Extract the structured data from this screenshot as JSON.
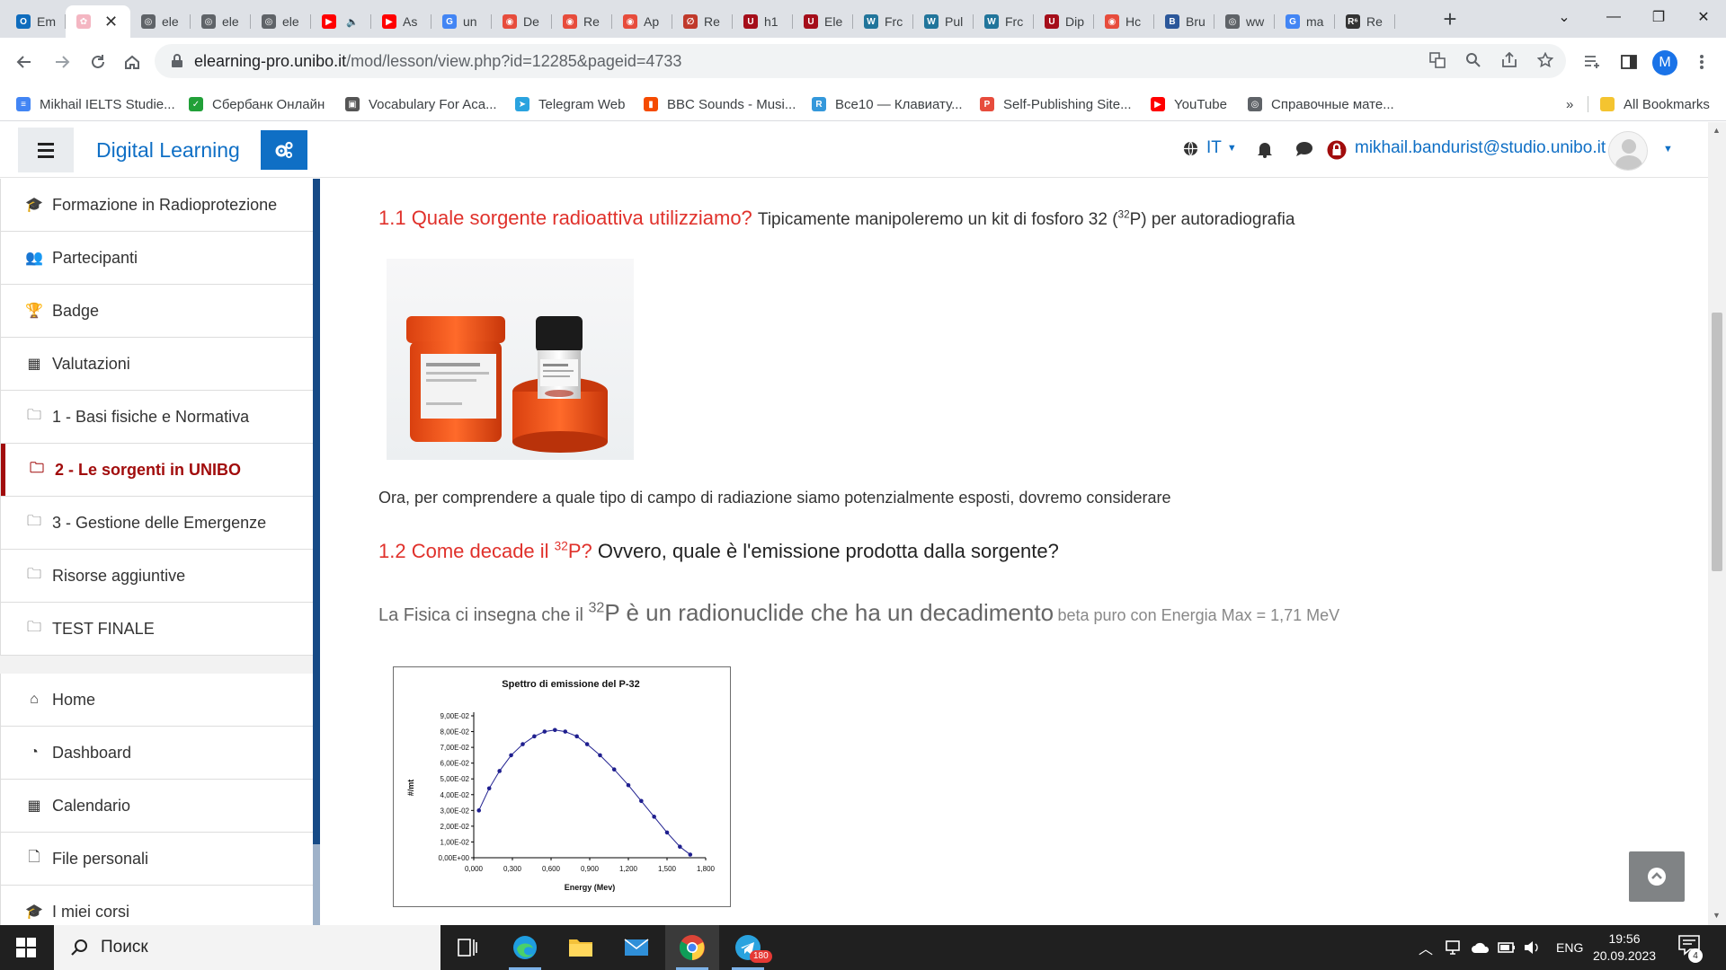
{
  "browser": {
    "tabs": [
      {
        "label": "Em",
        "icon": "outlook",
        "color": "#0f6cbd",
        "glyph": "O"
      },
      {
        "label": "",
        "icon": "flower",
        "color": "#f4b6c2",
        "glyph": "✿",
        "active": true,
        "close": "✕"
      },
      {
        "label": "ele",
        "icon": "globe",
        "color": "#5f6368",
        "glyph": "◎"
      },
      {
        "label": "ele",
        "icon": "globe",
        "color": "#5f6368",
        "glyph": "◎"
      },
      {
        "label": "ele",
        "icon": "globe",
        "color": "#5f6368",
        "glyph": "◎"
      },
      {
        "label": "",
        "icon": "youtube",
        "color": "#ff0000",
        "glyph": "▶",
        "extra": "🔈"
      },
      {
        "label": "As",
        "icon": "youtube",
        "color": "#ff0000",
        "glyph": "▶"
      },
      {
        "label": "un",
        "icon": "google",
        "color": "#4285f4",
        "glyph": "G"
      },
      {
        "label": "De",
        "icon": "circle-red",
        "color": "#e74c3c",
        "glyph": "◉"
      },
      {
        "label": "Re",
        "icon": "circle-red",
        "color": "#e74c3c",
        "glyph": "◉"
      },
      {
        "label": "Ap",
        "icon": "circle-red",
        "color": "#e74c3c",
        "glyph": "◉"
      },
      {
        "label": "Re",
        "icon": "researchgate",
        "color": "#c0392b",
        "glyph": "∅"
      },
      {
        "label": "h1",
        "icon": "shield",
        "color": "#a50e1a",
        "glyph": "U"
      },
      {
        "label": "Ele",
        "icon": "shield",
        "color": "#a50e1a",
        "glyph": "U"
      },
      {
        "label": "Frc",
        "icon": "wordpress",
        "color": "#21759b",
        "glyph": "W"
      },
      {
        "label": "Pul",
        "icon": "wordpress",
        "color": "#21759b",
        "glyph": "W"
      },
      {
        "label": "Frc",
        "icon": "wordpress",
        "color": "#21759b",
        "glyph": "W"
      },
      {
        "label": "Dip",
        "icon": "shield",
        "color": "#a50e1a",
        "glyph": "U"
      },
      {
        "label": "Hc",
        "icon": "circle-red",
        "color": "#e74c3c",
        "glyph": "◉"
      },
      {
        "label": "Bru",
        "icon": "doc",
        "color": "#2b579a",
        "glyph": "B"
      },
      {
        "label": "ww",
        "icon": "globe",
        "color": "#5f6368",
        "glyph": "◎"
      },
      {
        "label": "ma",
        "icon": "google",
        "color": "#4285f4",
        "glyph": "G"
      },
      {
        "label": "Re",
        "icon": "r6",
        "color": "#333333",
        "glyph": "R⁶"
      }
    ],
    "new_tab": "+",
    "window_controls": {
      "chevron": "⌄",
      "minimize": "—",
      "restore": "❐",
      "close": "✕"
    },
    "url": {
      "host": "elearning-pro.unibo.it",
      "path": "/mod/lesson/view.php?id=12285&pageid=4733"
    },
    "profile_letter": "M"
  },
  "bookmarks": [
    {
      "label": "Mikhail IELTS Studie...",
      "icon": "docs-icon",
      "color": "#4285f4",
      "glyph": "≡"
    },
    {
      "label": "Сбербанк Онлайн",
      "icon": "sber-icon",
      "color": "#21a038",
      "glyph": "✓"
    },
    {
      "label": "Vocabulary For Aca...",
      "icon": "ielts-icon",
      "color": "#555555",
      "glyph": "▣"
    },
    {
      "label": "Telegram Web",
      "icon": "telegram-icon",
      "color": "#2aa3df",
      "glyph": "➤"
    },
    {
      "label": "BBC Sounds - Musi...",
      "icon": "bbc-icon",
      "color": "#f54b00",
      "glyph": "▮"
    },
    {
      "label": "Все10 — Клавиату...",
      "icon": "keyboard-icon",
      "color": "#3498db",
      "glyph": "R"
    },
    {
      "label": "Self-Publishing Site...",
      "icon": "p-icon",
      "color": "#e74c3c",
      "glyph": "P"
    },
    {
      "label": "YouTube",
      "icon": "youtube-icon",
      "color": "#ff0000",
      "glyph": "▶"
    },
    {
      "label": "Справочные мате...",
      "icon": "globe-icon",
      "color": "#5f6368",
      "glyph": "◎"
    }
  ],
  "bookmarks_more": "»",
  "bookmarks_all": "All Bookmarks",
  "moodle": {
    "brand": "Digital Learning",
    "language": "IT",
    "user_email": "mikhail.bandurist@studio.unibo.it"
  },
  "drawer": {
    "course_items": [
      {
        "label": "Formazione in Radioprotezione",
        "icon": "graduation-cap-icon",
        "glyph": "🎓"
      },
      {
        "label": "Partecipanti",
        "icon": "users-icon",
        "glyph": "👥"
      },
      {
        "label": "Badge",
        "icon": "trophy-icon",
        "glyph": "🏆"
      },
      {
        "label": "Valutazioni",
        "icon": "table-icon",
        "glyph": "▦"
      },
      {
        "label": "1 - Basi fisiche e Normativa",
        "icon": "folder-icon",
        "glyph": "🗀"
      },
      {
        "label": "2 - Le sorgenti in UNIBO",
        "icon": "folder-icon",
        "glyph": "🗀",
        "active": true
      },
      {
        "label": "3 - Gestione delle Emergenze",
        "icon": "folder-icon",
        "glyph": "🗀"
      },
      {
        "label": "Risorse aggiuntive",
        "icon": "folder-icon",
        "glyph": "🗀"
      },
      {
        "label": "TEST FINALE",
        "icon": "folder-icon",
        "glyph": "🗀"
      }
    ],
    "site_items": [
      {
        "label": "Home",
        "icon": "home-icon",
        "glyph": "⌂"
      },
      {
        "label": "Dashboard",
        "icon": "dashboard-icon",
        "glyph": "◔"
      },
      {
        "label": "Calendario",
        "icon": "calendar-icon",
        "glyph": "▦"
      },
      {
        "label": "File personali",
        "icon": "file-icon",
        "glyph": "🗋"
      },
      {
        "label": "I miei corsi",
        "icon": "graduation-cap-icon",
        "glyph": "🎓"
      }
    ]
  },
  "content": {
    "q11_heading": "1.1 Quale sorgente radioattiva utilizziamo?",
    "q11_text_pre": "Tipicamente manipoleremo un kit di fosforo 32 (",
    "q11_sup": "32",
    "q11_text_post": "P) per autoradiografia",
    "intro_paragraph": "Ora, per comprendere a quale tipo di campo di radiazione siamo potenzialmente esposti, dovremo considerare",
    "q12_heading_pre": "1.2 Come decade il ",
    "q12_sup": "32",
    "q12_heading_post": "P?",
    "q12_text": "Ovvero, quale è l'emissione prodotta dalla sorgente?",
    "fisica_a": "La Fisica ci insegna che il ",
    "fisica_sup": "32",
    "fisica_b": "P è un radionuclide che ha un decadimento",
    "fisica_c": "beta puro con Energia Max = 1,71 MeV"
  },
  "chart_data": {
    "type": "scatter",
    "title": "Spettro di emissione  del P-32",
    "xlabel": "Energy (Mev)",
    "ylabel": "#/mt",
    "xlim": [
      0,
      1.8
    ],
    "ylim": [
      0,
      0.09
    ],
    "x_ticks": [
      "0,000",
      "0,300",
      "0,600",
      "0,900",
      "1,200",
      "1,500",
      "1,800"
    ],
    "y_ticks": [
      "0,00E+00",
      "1,00E-02",
      "2,00E-02",
      "3,00E-02",
      "4,00E-02",
      "5,00E-02",
      "6,00E-02",
      "7,00E-02",
      "8,00E-02",
      "9,00E-02"
    ],
    "grid": false,
    "legend": "none",
    "marker_color": "#1f1f8f",
    "line_color": "#1f1f8f",
    "series": [
      {
        "x": [
          0.04,
          0.12,
          0.2,
          0.29,
          0.38,
          0.47,
          0.55,
          0.63,
          0.71,
          0.8,
          0.88,
          0.98,
          1.09,
          1.2,
          1.3,
          1.4,
          1.5,
          1.6,
          1.68
        ],
        "y": [
          0.03,
          0.044,
          0.055,
          0.065,
          0.072,
          0.077,
          0.08,
          0.081,
          0.08,
          0.077,
          0.072,
          0.065,
          0.056,
          0.046,
          0.036,
          0.026,
          0.016,
          0.007,
          0.002
        ]
      }
    ]
  },
  "back_to_top": "▲",
  "taskbar": {
    "search_placeholder": "Поиск",
    "apps": [
      {
        "name": "task-view",
        "glyph": "⧉"
      },
      {
        "name": "edge",
        "glyph": "e"
      },
      {
        "name": "file-explorer",
        "glyph": "▬"
      },
      {
        "name": "mail",
        "glyph": "✉"
      },
      {
        "name": "chrome",
        "glyph": "◉",
        "active": true
      },
      {
        "name": "telegram",
        "glyph": "➤",
        "badge": "180"
      }
    ],
    "tray_language": "ENG",
    "time": "19:56",
    "date": "20.09.2023",
    "notification_count": "4"
  }
}
